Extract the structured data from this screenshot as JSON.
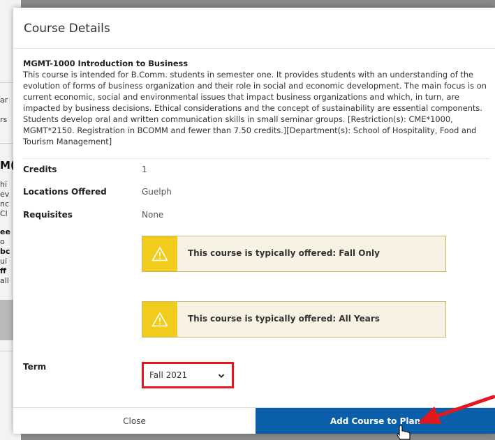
{
  "background": {
    "fragments": [
      "ar",
      "rs",
      "M(",
      "hi",
      "ev",
      "nc",
      "Cl",
      "ee",
      "o",
      "bc",
      "ui",
      "ff",
      "all"
    ]
  },
  "modal": {
    "title": "Course Details",
    "course_heading": "MGMT-1000 Introduction to Business",
    "description": "This course is intended for B.Comm. students in semester one. It provides students with an understanding of the evolution of forms of business organization and their role in social and economic development. The main focus is on current economic, social and environmental issues that impact business organizations and which, in turn, are impacted by business decisions. Ethical considerations and the concept of sustainability are essential components. Students develop oral and written communication skills in small seminar groups. [Restriction(s): CME*1000, MGMT*2150. Registration in BCOMM and fewer than 7.50 credits.][Department(s): School of Hospitality, Food and Tourism Management]",
    "details": [
      {
        "label": "Credits",
        "value": "1"
      },
      {
        "label": "Locations Offered",
        "value": "Guelph"
      },
      {
        "label": "Requisites",
        "value": "None"
      }
    ],
    "alerts": [
      {
        "text": "This course is typically offered: Fall Only",
        "icon": "warning-icon"
      },
      {
        "text": "This course is typically offered: All Years",
        "icon": "warning-icon"
      }
    ],
    "term": {
      "label": "Term",
      "selected": "Fall 2021"
    },
    "buttons": {
      "close": "Close",
      "add": "Add Course to Plan"
    }
  },
  "colors": {
    "primary_button": "#0a5eaa",
    "alert_accent": "#f2cc1c",
    "highlight_red": "#e4161e"
  }
}
